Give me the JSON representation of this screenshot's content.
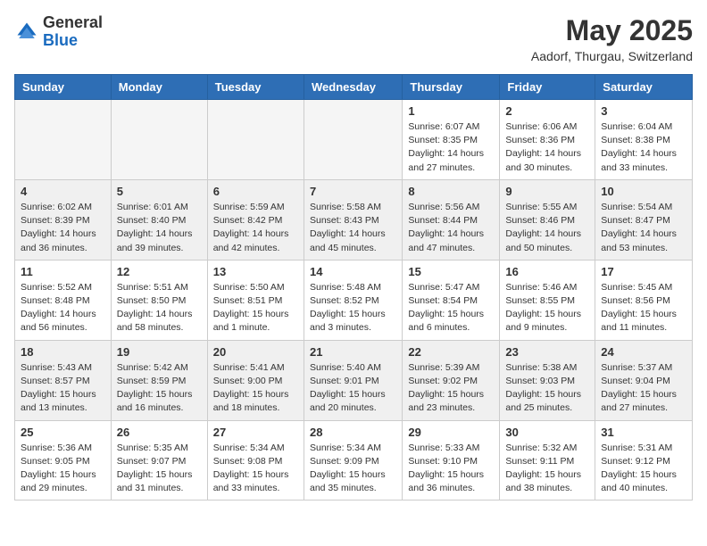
{
  "header": {
    "logo_general": "General",
    "logo_blue": "Blue",
    "month_title": "May 2025",
    "location": "Aadorf, Thurgau, Switzerland"
  },
  "days_of_week": [
    "Sunday",
    "Monday",
    "Tuesday",
    "Wednesday",
    "Thursday",
    "Friday",
    "Saturday"
  ],
  "weeks": [
    {
      "shaded": false,
      "days": [
        {
          "num": "",
          "info": "",
          "empty": true
        },
        {
          "num": "",
          "info": "",
          "empty": true
        },
        {
          "num": "",
          "info": "",
          "empty": true
        },
        {
          "num": "",
          "info": "",
          "empty": true
        },
        {
          "num": "1",
          "info": "Sunrise: 6:07 AM\nSunset: 8:35 PM\nDaylight: 14 hours\nand 27 minutes."
        },
        {
          "num": "2",
          "info": "Sunrise: 6:06 AM\nSunset: 8:36 PM\nDaylight: 14 hours\nand 30 minutes."
        },
        {
          "num": "3",
          "info": "Sunrise: 6:04 AM\nSunset: 8:38 PM\nDaylight: 14 hours\nand 33 minutes."
        }
      ]
    },
    {
      "shaded": true,
      "days": [
        {
          "num": "4",
          "info": "Sunrise: 6:02 AM\nSunset: 8:39 PM\nDaylight: 14 hours\nand 36 minutes."
        },
        {
          "num": "5",
          "info": "Sunrise: 6:01 AM\nSunset: 8:40 PM\nDaylight: 14 hours\nand 39 minutes."
        },
        {
          "num": "6",
          "info": "Sunrise: 5:59 AM\nSunset: 8:42 PM\nDaylight: 14 hours\nand 42 minutes."
        },
        {
          "num": "7",
          "info": "Sunrise: 5:58 AM\nSunset: 8:43 PM\nDaylight: 14 hours\nand 45 minutes."
        },
        {
          "num": "8",
          "info": "Sunrise: 5:56 AM\nSunset: 8:44 PM\nDaylight: 14 hours\nand 47 minutes."
        },
        {
          "num": "9",
          "info": "Sunrise: 5:55 AM\nSunset: 8:46 PM\nDaylight: 14 hours\nand 50 minutes."
        },
        {
          "num": "10",
          "info": "Sunrise: 5:54 AM\nSunset: 8:47 PM\nDaylight: 14 hours\nand 53 minutes."
        }
      ]
    },
    {
      "shaded": false,
      "days": [
        {
          "num": "11",
          "info": "Sunrise: 5:52 AM\nSunset: 8:48 PM\nDaylight: 14 hours\nand 56 minutes."
        },
        {
          "num": "12",
          "info": "Sunrise: 5:51 AM\nSunset: 8:50 PM\nDaylight: 14 hours\nand 58 minutes."
        },
        {
          "num": "13",
          "info": "Sunrise: 5:50 AM\nSunset: 8:51 PM\nDaylight: 15 hours\nand 1 minute."
        },
        {
          "num": "14",
          "info": "Sunrise: 5:48 AM\nSunset: 8:52 PM\nDaylight: 15 hours\nand 3 minutes."
        },
        {
          "num": "15",
          "info": "Sunrise: 5:47 AM\nSunset: 8:54 PM\nDaylight: 15 hours\nand 6 minutes."
        },
        {
          "num": "16",
          "info": "Sunrise: 5:46 AM\nSunset: 8:55 PM\nDaylight: 15 hours\nand 9 minutes."
        },
        {
          "num": "17",
          "info": "Sunrise: 5:45 AM\nSunset: 8:56 PM\nDaylight: 15 hours\nand 11 minutes."
        }
      ]
    },
    {
      "shaded": true,
      "days": [
        {
          "num": "18",
          "info": "Sunrise: 5:43 AM\nSunset: 8:57 PM\nDaylight: 15 hours\nand 13 minutes."
        },
        {
          "num": "19",
          "info": "Sunrise: 5:42 AM\nSunset: 8:59 PM\nDaylight: 15 hours\nand 16 minutes."
        },
        {
          "num": "20",
          "info": "Sunrise: 5:41 AM\nSunset: 9:00 PM\nDaylight: 15 hours\nand 18 minutes."
        },
        {
          "num": "21",
          "info": "Sunrise: 5:40 AM\nSunset: 9:01 PM\nDaylight: 15 hours\nand 20 minutes."
        },
        {
          "num": "22",
          "info": "Sunrise: 5:39 AM\nSunset: 9:02 PM\nDaylight: 15 hours\nand 23 minutes."
        },
        {
          "num": "23",
          "info": "Sunrise: 5:38 AM\nSunset: 9:03 PM\nDaylight: 15 hours\nand 25 minutes."
        },
        {
          "num": "24",
          "info": "Sunrise: 5:37 AM\nSunset: 9:04 PM\nDaylight: 15 hours\nand 27 minutes."
        }
      ]
    },
    {
      "shaded": false,
      "days": [
        {
          "num": "25",
          "info": "Sunrise: 5:36 AM\nSunset: 9:05 PM\nDaylight: 15 hours\nand 29 minutes."
        },
        {
          "num": "26",
          "info": "Sunrise: 5:35 AM\nSunset: 9:07 PM\nDaylight: 15 hours\nand 31 minutes."
        },
        {
          "num": "27",
          "info": "Sunrise: 5:34 AM\nSunset: 9:08 PM\nDaylight: 15 hours\nand 33 minutes."
        },
        {
          "num": "28",
          "info": "Sunrise: 5:34 AM\nSunset: 9:09 PM\nDaylight: 15 hours\nand 35 minutes."
        },
        {
          "num": "29",
          "info": "Sunrise: 5:33 AM\nSunset: 9:10 PM\nDaylight: 15 hours\nand 36 minutes."
        },
        {
          "num": "30",
          "info": "Sunrise: 5:32 AM\nSunset: 9:11 PM\nDaylight: 15 hours\nand 38 minutes."
        },
        {
          "num": "31",
          "info": "Sunrise: 5:31 AM\nSunset: 9:12 PM\nDaylight: 15 hours\nand 40 minutes."
        }
      ]
    }
  ]
}
